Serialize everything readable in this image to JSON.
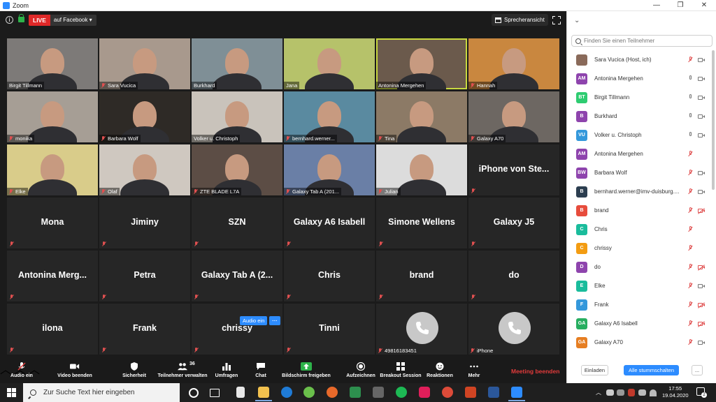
{
  "window": {
    "title": "Zoom",
    "controls": [
      "—",
      "❐",
      "✕"
    ]
  },
  "topbar": {
    "live_label": "LIVE",
    "live_destination": "auf Facebook ▾",
    "speaker_view": "Sprecheransicht"
  },
  "tiles": [
    {
      "name": "Birgit Tillmann",
      "video": true,
      "muted": false,
      "bg": "#7d7a78"
    },
    {
      "name": "Sara Vucica",
      "video": true,
      "muted": true,
      "bg": "#a8998d"
    },
    {
      "name": "Burkhard",
      "video": true,
      "muted": false,
      "bg": "#7f8f96"
    },
    {
      "name": "Jana",
      "video": true,
      "muted": false,
      "bg": "#b6c26a"
    },
    {
      "name": "Antonina Mergehen",
      "video": true,
      "muted": false,
      "active": true,
      "bg": "#6b5a4c"
    },
    {
      "name": "Hannah",
      "video": true,
      "muted": true,
      "bg": "#c9873f"
    },
    {
      "name": "monika",
      "video": true,
      "muted": true,
      "bg": "#a69e95"
    },
    {
      "name": "Barbara Wolf",
      "video": true,
      "muted": true,
      "bg": "#2e2a26"
    },
    {
      "name": "Volker u. Christoph",
      "video": true,
      "muted": false,
      "bg": "#c9c3bb"
    },
    {
      "name": "bernhard.werner...",
      "video": true,
      "muted": true,
      "bg": "#5a8aa0"
    },
    {
      "name": "Tina",
      "video": true,
      "muted": true,
      "bg": "#8c7a66"
    },
    {
      "name": "Galaxy A70",
      "video": true,
      "muted": true,
      "bg": "#6d6762"
    },
    {
      "name": "Elke",
      "video": true,
      "muted": true,
      "bg": "#d9cc8a"
    },
    {
      "name": "Olaf",
      "video": true,
      "muted": true,
      "bg": "#cfc8c0"
    },
    {
      "name": "ZTE BLADE L7A",
      "video": true,
      "muted": true,
      "bg": "#5c4d45"
    },
    {
      "name": "Galaxy Tab A (201...",
      "video": true,
      "muted": true,
      "bg": "#6a7fa6"
    },
    {
      "name": "Julian",
      "video": true,
      "muted": true,
      "bg": "#dcdcdc"
    },
    {
      "name": "iPhone von Ste...",
      "video": false,
      "muted": true
    },
    {
      "name": "Mona",
      "video": false,
      "muted": true
    },
    {
      "name": "Jiminy",
      "video": false,
      "muted": true
    },
    {
      "name": "SZN",
      "video": false,
      "muted": true
    },
    {
      "name": "Galaxy A6 Isabell",
      "video": false,
      "muted": true
    },
    {
      "name": "Simone Wellens",
      "video": false,
      "muted": true
    },
    {
      "name": "Galaxy J5",
      "video": false,
      "muted": true
    },
    {
      "name": "Antonina Merg...",
      "video": false,
      "muted": true
    },
    {
      "name": "Petra",
      "video": false,
      "muted": true
    },
    {
      "name": "Galaxy Tab A (2...",
      "video": false,
      "muted": true
    },
    {
      "name": "Chris",
      "video": false,
      "muted": true
    },
    {
      "name": "brand",
      "video": false,
      "muted": true
    },
    {
      "name": "do",
      "video": false,
      "muted": true
    },
    {
      "name": "ilona",
      "video": false,
      "muted": true
    },
    {
      "name": "Frank",
      "video": false,
      "muted": true
    },
    {
      "name": "chrissy",
      "video": false,
      "muted": true
    },
    {
      "name": "Tinni",
      "video": false,
      "muted": true
    },
    {
      "name": "49816183451",
      "phone": true,
      "muted": true
    },
    {
      "name": "iPhone",
      "phone": true,
      "muted": true
    }
  ],
  "hover_actions": {
    "audio_on": "Audio ein",
    "more": "···"
  },
  "toolbar": {
    "items": [
      {
        "label": "Audio ein",
        "icon": "mic-off-icon"
      },
      {
        "label": "Video beenden",
        "icon": "video-camera-icon"
      },
      {
        "label": "Sicherheit",
        "icon": "shield-icon"
      },
      {
        "label": "Teilnehmer verwalten",
        "icon": "participants-icon",
        "count": "36"
      },
      {
        "label": "Umfragen",
        "icon": "poll-icon"
      },
      {
        "label": "Chat",
        "icon": "chat-icon"
      },
      {
        "label": "Bildschirm freigeben",
        "icon": "share-screen-icon"
      },
      {
        "label": "Aufzeichnen",
        "icon": "record-icon"
      },
      {
        "label": "Breakout Session",
        "icon": "breakout-icon"
      },
      {
        "label": "Reaktionen",
        "icon": "reactions-icon"
      },
      {
        "label": "Mehr",
        "icon": "more-icon"
      }
    ],
    "end_meeting": "Meeting beenden"
  },
  "panel": {
    "search_placeholder": "Finden Sie einen Teilnehmer",
    "participants": [
      {
        "name": "Sara Vucica (Host, ich)",
        "initials": "",
        "color": "#8a6a5a",
        "mic": "off",
        "cam": "on"
      },
      {
        "name": "Antonina Mergehen",
        "initials": "AM",
        "color": "#8e44ad",
        "mic": "on",
        "cam": "on"
      },
      {
        "name": "Birgit Tillmann",
        "initials": "BT",
        "color": "#2ecc71",
        "mic": "on",
        "cam": "on"
      },
      {
        "name": "Burkhard",
        "initials": "B",
        "color": "#8e44ad",
        "mic": "on",
        "cam": "on"
      },
      {
        "name": "Volker u. Christoph",
        "initials": "VU",
        "color": "#3498db",
        "mic": "on",
        "cam": "on"
      },
      {
        "name": "Antonina Mergehen",
        "initials": "AM",
        "color": "#8e44ad",
        "mic": "off",
        "cam": "none"
      },
      {
        "name": "Barbara Wolf",
        "initials": "BW",
        "color": "#8e44ad",
        "mic": "off",
        "cam": "on"
      },
      {
        "name": "bernhard.werner@imv-duisburg....",
        "initials": "B",
        "color": "#2c3e50",
        "mic": "off",
        "cam": "on"
      },
      {
        "name": "brand",
        "initials": "B",
        "color": "#e74c3c",
        "mic": "off",
        "cam": "off"
      },
      {
        "name": "Chris",
        "initials": "C",
        "color": "#1abc9c",
        "mic": "off",
        "cam": "none"
      },
      {
        "name": "chrissy",
        "initials": "C",
        "color": "#f39c12",
        "mic": "off",
        "cam": "none"
      },
      {
        "name": "do",
        "initials": "D",
        "color": "#8e44ad",
        "mic": "off",
        "cam": "off"
      },
      {
        "name": "Elke",
        "initials": "E",
        "color": "#1abc9c",
        "mic": "off",
        "cam": "on"
      },
      {
        "name": "Frank",
        "initials": "F",
        "color": "#3498db",
        "mic": "off",
        "cam": "off"
      },
      {
        "name": "Galaxy A6 Isabell",
        "initials": "GA",
        "color": "#27ae60",
        "mic": "off",
        "cam": "off"
      },
      {
        "name": "Galaxy A70",
        "initials": "GA",
        "color": "#e67e22",
        "mic": "off",
        "cam": "on"
      }
    ],
    "invite": "Einladen",
    "mute_all": "Alle stummschalten",
    "more": "..."
  },
  "taskbar": {
    "search_text": "Zur Suche Text hier eingeben",
    "time": "17:55",
    "date": "19.04.2020",
    "notifications": "2"
  }
}
